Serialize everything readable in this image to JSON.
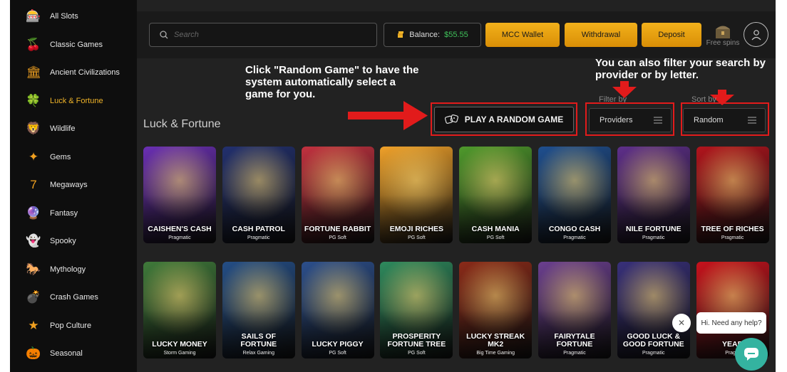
{
  "sidebar": {
    "items": [
      {
        "label": "All Slots",
        "icon": "slot-machine-icon"
      },
      {
        "label": "Classic Games",
        "icon": "cherries-icon"
      },
      {
        "label": "Ancient Civilizations",
        "icon": "column-icon"
      },
      {
        "label": "Luck & Fortune",
        "icon": "clover-icon",
        "active": true
      },
      {
        "label": "Wildlife",
        "icon": "lion-icon"
      },
      {
        "label": "Gems",
        "icon": "gem-icon"
      },
      {
        "label": "Megaways",
        "icon": "777-icon"
      },
      {
        "label": "Fantasy",
        "icon": "crystal-ball-icon"
      },
      {
        "label": "Spooky",
        "icon": "ghost-icon"
      },
      {
        "label": "Mythology",
        "icon": "pegasus-icon"
      },
      {
        "label": "Crash Games",
        "icon": "bomb-icon"
      },
      {
        "label": "Pop Culture",
        "icon": "star-icon"
      },
      {
        "label": "Seasonal",
        "icon": "pumpkin-icon"
      }
    ]
  },
  "header": {
    "search_placeholder": "Search",
    "balance_label": "Balance:",
    "balance_value": "$55.55",
    "mcc_wallet": "MCC Wallet",
    "withdrawal": "Withdrawal",
    "deposit": "Deposit",
    "free_spins": "Free spins"
  },
  "annotations": {
    "random_note": "Click \"Random Game\" to have the system automatically select a game for you.",
    "filter_note": "You can also filter your search by provider or by letter."
  },
  "section": {
    "title": "Luck & Fortune",
    "random_button": "PLAY A RANDOM GAME",
    "filter_label": "Filter by",
    "filter_value": "Providers",
    "sort_label": "Sort by",
    "sort_value": "Random"
  },
  "games": [
    {
      "title": "CAISHEN'S CASH",
      "provider": "Pragmatic",
      "color": "#6a2fb3"
    },
    {
      "title": "CASH PATROL",
      "provider": "Pragmatic",
      "color": "#22306e"
    },
    {
      "title": "FORTUNE RABBIT",
      "provider": "PG Soft",
      "color": "#c2313f"
    },
    {
      "title": "EMOJI RICHES",
      "provider": "PG Soft",
      "color": "#f0a129"
    },
    {
      "title": "CASH MANIA",
      "provider": "PG Soft",
      "color": "#4f9a2c"
    },
    {
      "title": "CONGO CASH",
      "provider": "Pragmatic",
      "color": "#1f4f8f"
    },
    {
      "title": "NILE FORTUNE",
      "provider": "Pragmatic",
      "color": "#5e2f8a"
    },
    {
      "title": "TREE OF RICHES",
      "provider": "Pragmatic",
      "color": "#b1141c"
    },
    {
      "title": "LUCKY MONEY",
      "provider": "Storm Gaming",
      "color": "#3f7a3a"
    },
    {
      "title": "SAILS OF FORTUNE",
      "provider": "Relax Gaming",
      "color": "#244e86"
    },
    {
      "title": "LUCKY PIGGY",
      "provider": "PG Soft",
      "color": "#2c4f8c"
    },
    {
      "title": "PROSPERITY FORTUNE TREE",
      "provider": "PG Soft",
      "color": "#2e8a5d"
    },
    {
      "title": "LUCKY STREAK MK2",
      "provider": "Big Time Gaming",
      "color": "#8a2a18"
    },
    {
      "title": "FAIRYTALE FORTUNE",
      "provider": "Pragmatic",
      "color": "#6b3f8f"
    },
    {
      "title": "GOOD LUCK & GOOD FORTUNE",
      "provider": "Pragmatic",
      "color": "#38307a"
    },
    {
      "title": "YEAR",
      "provider": "Pragm",
      "color": "#c8121c"
    }
  ],
  "chat": {
    "bubble_text": "Hi. Need any help?",
    "close": "✕"
  },
  "colors": {
    "accent": "#f0b429",
    "highlight": "#e21b1b",
    "chat": "#34b3a0"
  }
}
